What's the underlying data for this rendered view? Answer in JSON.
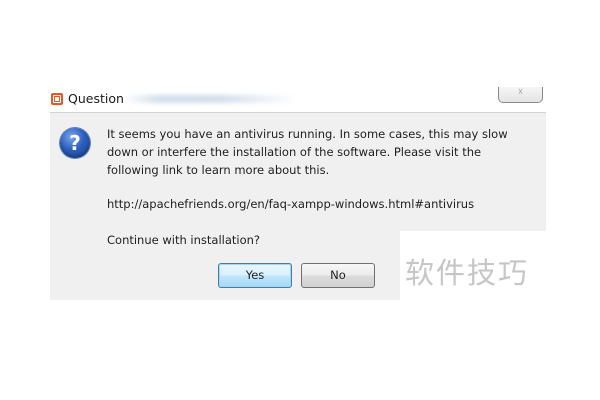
{
  "window": {
    "title": "Question",
    "close_glyph": "☓"
  },
  "dialog": {
    "icon": "question-icon",
    "icon_glyph": "?",
    "message": "It seems you have an antivirus running. In some cases, this may slow\ndown or interfere the installation of the software. Please visit the\nfollowing link to learn more about this.",
    "link": "http://apachefriends.org/en/faq-xampp-windows.html#antivirus",
    "prompt": "Continue with installation?",
    "buttons": {
      "yes": "Yes",
      "no": "No"
    }
  },
  "watermark": {
    "text": "软件技巧"
  },
  "colors": {
    "dialog_bg": "#f0f0f0",
    "app_icon": "#e8542c",
    "question_icon": "#2c5fbf",
    "default_button_border": "#3c7fb1"
  }
}
